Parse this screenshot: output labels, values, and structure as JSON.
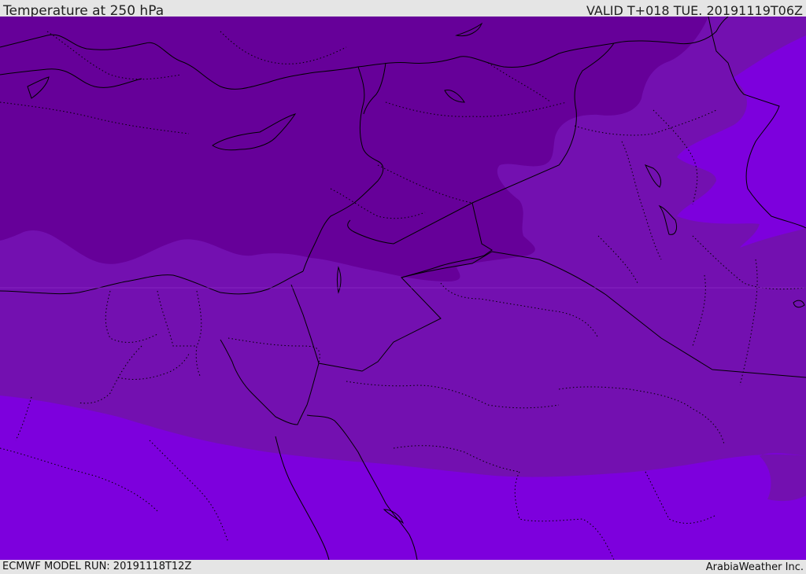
{
  "header": {
    "title": "Temperature at 250 hPa",
    "valid": "VALID T+018 TUE. 20191119T06Z"
  },
  "footer": {
    "model_run": "ECMWF MODEL RUN: 20191118T12Z",
    "credit": "ArabiaWeather Inc."
  },
  "colors": {
    "coldest_band": "#660099",
    "cold_band": "#7310b0",
    "mid_band": "#7d00dd",
    "border_line": "#000000"
  }
}
